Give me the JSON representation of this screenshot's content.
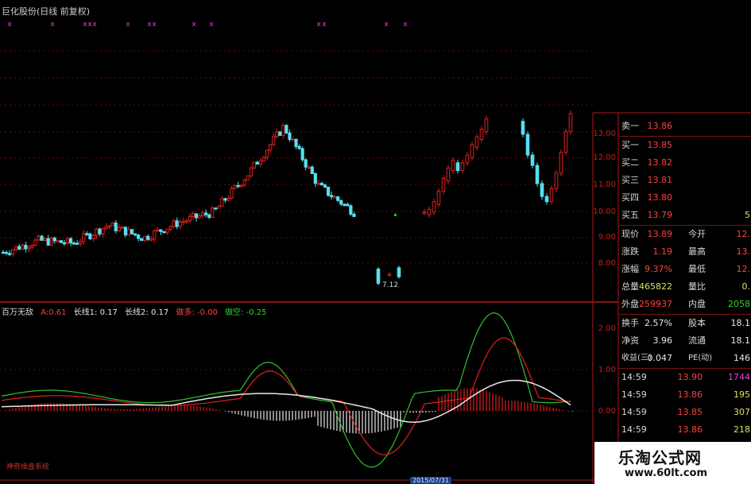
{
  "title": "巨化股份(日线 前复权)",
  "colors": {
    "up": "#e02020",
    "down": "#54e0f0",
    "green": "#30c030",
    "white": "#e8e8e8",
    "grid": "#6a0a0a",
    "red": "#ff4040",
    "yellow": "#e0e060",
    "magenta": "#e040e0"
  },
  "price_axis": [
    "13.00",
    "12.00",
    "11.00",
    "10.00",
    "9.00",
    "8.00"
  ],
  "min_price_label": "7.12",
  "marker_char": "x",
  "indicator": {
    "name": "百万无敌",
    "a_label": "A:",
    "a_value": "0.61",
    "l1_label": "长线1:",
    "l1_value": "0.17",
    "l2_label": "长线2:",
    "l2_value": "0.17",
    "bull_label": "做多:",
    "bull_value": "-0.00",
    "bear_label": "做空:",
    "bear_value": "-0.25",
    "axis": [
      "2.00",
      "1.00",
      "0.00"
    ]
  },
  "quote": {
    "sell1_label": "卖一",
    "sell1_price": "13.86",
    "buys": [
      {
        "label": "买一",
        "price": "13.85"
      },
      {
        "label": "买二",
        "price": "13.82"
      },
      {
        "label": "买三",
        "price": "13.81"
      },
      {
        "label": "买四",
        "price": "13.80"
      },
      {
        "label": "买五",
        "price": "13.79",
        "vol": "5"
      }
    ],
    "stats": [
      {
        "l": "现价",
        "v": "13.89",
        "l2": "今开",
        "v2": "12."
      },
      {
        "l": "涨跌",
        "v": "1.19",
        "l2": "最高",
        "v2": "13."
      },
      {
        "l": "涨幅",
        "v": "9.37%",
        "l2": "最低",
        "v2": "12."
      },
      {
        "l": "总量",
        "v": "465822",
        "l2": "量比",
        "v2": "0."
      },
      {
        "l": "外盘",
        "v": "259937",
        "l2": "内盘",
        "v2": "2058"
      }
    ],
    "fund": [
      {
        "l": "换手",
        "v": "2.57%",
        "l2": "股本",
        "v2": "18.1"
      },
      {
        "l": "净资",
        "v": "3.96",
        "l2": "流通",
        "v2": "18.1"
      },
      {
        "l": "收益(三)",
        "v": "0.047",
        "l2": "PE(动)",
        "v2": "146"
      }
    ],
    "ticks": [
      {
        "t": "14:59",
        "p": "13.90",
        "v": "1744"
      },
      {
        "t": "14:59",
        "p": "13.86",
        "v": "195"
      },
      {
        "t": "14:59",
        "p": "13.85",
        "v": "307"
      },
      {
        "t": "14:59",
        "p": "13.86",
        "v": "218"
      }
    ]
  },
  "watermark": {
    "name": "乐淘公式网",
    "url": "www.60lt.com"
  },
  "footer_text": "神奇操盘系统",
  "date_label": "2015/07/31"
}
